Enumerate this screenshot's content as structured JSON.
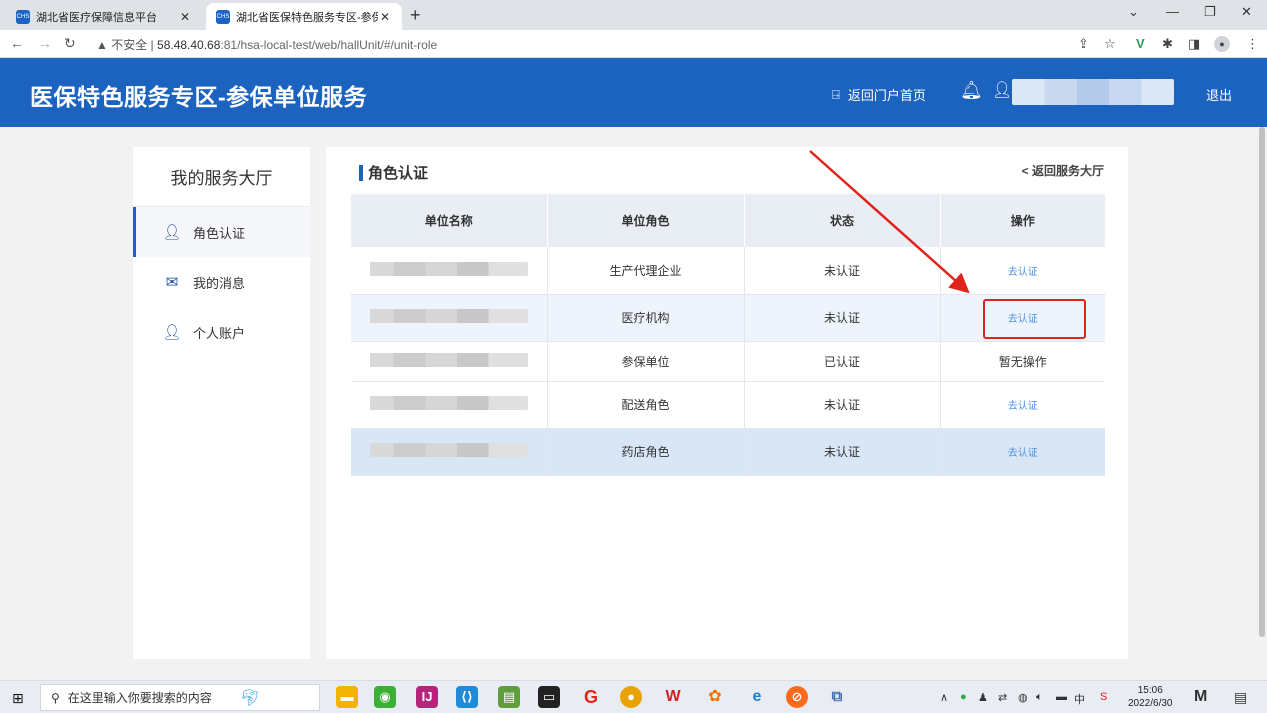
{
  "browser": {
    "tabs": [
      {
        "title": "湖北省医疗保障信息平台",
        "active": false
      },
      {
        "title": "湖北省医保特色服务专区-参保单",
        "active": true
      }
    ],
    "url_security": "▲ 不安全 |",
    "url_host": "58.48.40.68",
    "url_path": ":81/hsa-local-test/web/hallUnit/#/unit-role"
  },
  "header": {
    "title": "医保特色服务专区-参保单位服务",
    "back_portal": "返回门户首页",
    "logout": "退出"
  },
  "sidebar": {
    "title": "我的服务大厅",
    "items": [
      {
        "label": "角色认证",
        "icon": "user-badge-icon",
        "active": true
      },
      {
        "label": "我的消息",
        "icon": "envelope-icon",
        "active": false
      },
      {
        "label": "个人账户",
        "icon": "person-icon",
        "active": false
      }
    ]
  },
  "main": {
    "title": "角色认证",
    "back_hall": "< 返回服务大厅",
    "columns": [
      "单位名称",
      "单位角色",
      "状态",
      "操作"
    ],
    "rows": [
      {
        "role": "生产代理企业",
        "status": "未认证",
        "action": "去认证"
      },
      {
        "role": "医疗机构",
        "status": "未认证",
        "action": "去认证"
      },
      {
        "role": "参保单位",
        "status": "已认证",
        "action": "暂无操作"
      },
      {
        "role": "配送角色",
        "status": "未认证",
        "action": "去认证"
      },
      {
        "role": "药店角色",
        "status": "未认证",
        "action": "去认证"
      }
    ]
  },
  "taskbar": {
    "search_placeholder": "在这里输入你要搜索的内容",
    "time": "15:06",
    "date": "2022/6/30"
  },
  "colors": {
    "brand": "#1c63c0",
    "link": "#4a90e2",
    "annotation": "#e0231b"
  }
}
